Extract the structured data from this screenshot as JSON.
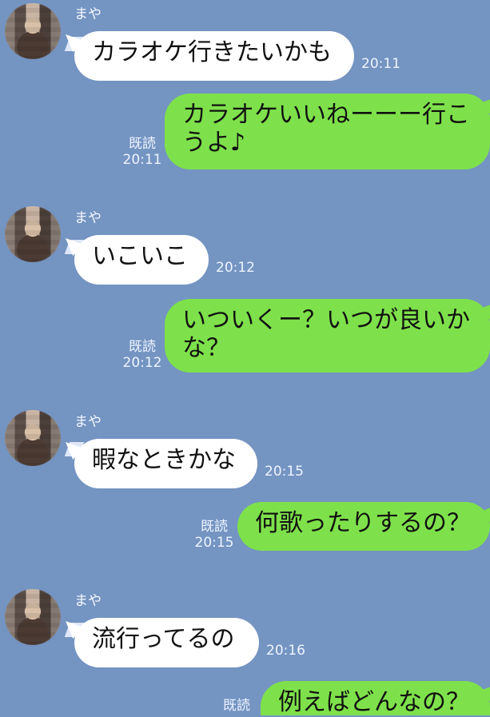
{
  "conversation": {
    "messages": [
      {
        "side": "left",
        "sender": "まや",
        "text": "カラオケ行きたいかも",
        "time": "20:11"
      },
      {
        "side": "right",
        "read": "既読",
        "text": "カラオケいいねーーー行こ\nうよ♪",
        "time": "20:11"
      },
      {
        "side": "left",
        "sender": "まや",
        "text": "いこいこ",
        "time": "20:12"
      },
      {
        "side": "right",
        "read": "既読",
        "text": "いついくー？いつが良いか\nな？",
        "time": "20:12"
      },
      {
        "side": "left",
        "sender": "まや",
        "text": "暇なときかな",
        "time": "20:15"
      },
      {
        "side": "right",
        "read": "既読",
        "text": "何歌ったりするの？",
        "time": "20:15"
      },
      {
        "side": "left",
        "sender": "まや",
        "text": "流行ってるの",
        "time": "20:16"
      },
      {
        "side": "right",
        "read": "既読",
        "text": "例えばどんなの？",
        "time": ""
      }
    ]
  }
}
